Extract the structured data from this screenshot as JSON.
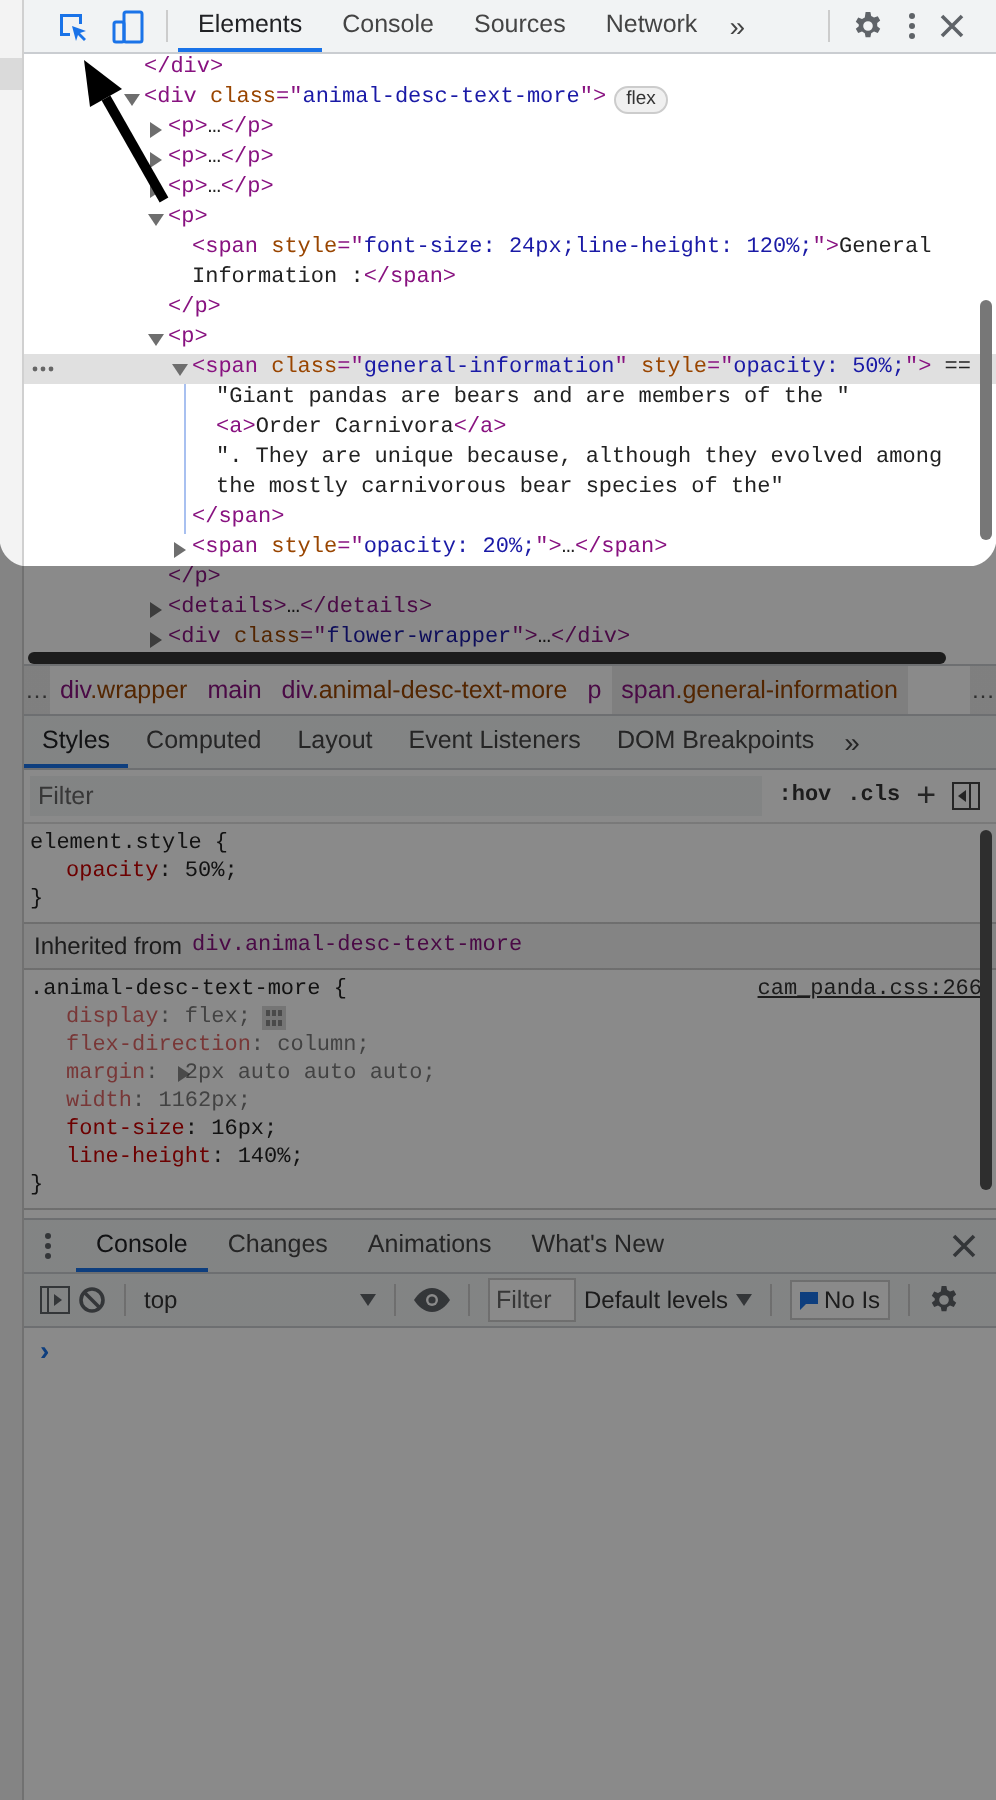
{
  "toolbar": {
    "tabs": [
      {
        "label": "Elements",
        "selected": true
      },
      {
        "label": "Console",
        "selected": false
      },
      {
        "label": "Sources",
        "selected": false
      },
      {
        "label": "Network",
        "selected": false
      }
    ],
    "more": "»"
  },
  "dom": [
    {
      "kind": "leaf",
      "selected": false,
      "line": [
        {
          "kind": "tag",
          "t": "</div>"
        }
      ]
    },
    {
      "kind": "element",
      "expanded": true,
      "selected": false,
      "badge": "flex",
      "line": [
        {
          "kind": "tag",
          "t": "<div "
        },
        {
          "kind": "attr",
          "t": "class"
        },
        {
          "kind": "tag",
          "t": "=\""
        },
        {
          "kind": "val",
          "t": "animal-desc-text-more"
        },
        {
          "kind": "tag",
          "t": "\">"
        }
      ],
      "children": [
        {
          "kind": "element",
          "expanded": false,
          "selected": false,
          "line": [
            {
              "kind": "tag",
              "t": "<p>"
            },
            {
              "kind": "text",
              "t": "…"
            },
            {
              "kind": "tag",
              "t": "</p>"
            }
          ]
        },
        {
          "kind": "element",
          "expanded": false,
          "selected": false,
          "line": [
            {
              "kind": "tag",
              "t": "<p>"
            },
            {
              "kind": "text",
              "t": "…"
            },
            {
              "kind": "tag",
              "t": "</p>"
            }
          ]
        },
        {
          "kind": "element",
          "expanded": false,
          "selected": false,
          "line": [
            {
              "kind": "tag",
              "t": "<p>"
            },
            {
              "kind": "text",
              "t": "…"
            },
            {
              "kind": "tag",
              "t": "</p>"
            }
          ]
        },
        {
          "kind": "element",
          "expanded": true,
          "selected": false,
          "line": [
            {
              "kind": "tag",
              "t": "<p>"
            }
          ],
          "close": [
            {
              "kind": "tag",
              "t": "</p>"
            }
          ],
          "children": [
            {
              "kind": "leaf",
              "selected": false,
              "line": [
                {
                  "kind": "tag",
                  "t": "<span "
                },
                {
                  "kind": "attr",
                  "t": "style"
                },
                {
                  "kind": "tag",
                  "t": "=\""
                },
                {
                  "kind": "val",
                  "t": "font-size: 24px;line-height: 120%;"
                },
                {
                  "kind": "tag",
                  "t": "\">"
                },
                {
                  "kind": "text",
                  "t": "General Information :"
                },
                {
                  "kind": "tag",
                  "t": "</span>"
                }
              ]
            }
          ]
        },
        {
          "kind": "element",
          "expanded": true,
          "selected": false,
          "line": [
            {
              "kind": "tag",
              "t": "<p>"
            }
          ],
          "close": [
            {
              "kind": "tag",
              "t": "</p>"
            }
          ],
          "children": [
            {
              "kind": "element",
              "expanded": true,
              "selected": true,
              "line": [
                {
                  "kind": "tag",
                  "t": "<span "
                },
                {
                  "kind": "attr",
                  "t": "class"
                },
                {
                  "kind": "tag",
                  "t": "=\""
                },
                {
                  "kind": "val",
                  "t": "general-information"
                },
                {
                  "kind": "tag",
                  "t": "\" "
                },
                {
                  "kind": "attr",
                  "t": "style"
                },
                {
                  "kind": "tag",
                  "t": "=\""
                },
                {
                  "kind": "val",
                  "t": "opacity: 50%;"
                },
                {
                  "kind": "tag",
                  "t": "\">"
                },
                {
                  "kind": "text",
                  "t": " =="
                }
              ],
              "close": [
                {
                  "kind": "tag",
                  "t": "</span>"
                }
              ],
              "children": [
                {
                  "kind": "leaf",
                  "selected": false,
                  "line": [
                    {
                      "kind": "text",
                      "t": "\"Giant pandas are bears and are members of the \""
                    }
                  ]
                },
                {
                  "kind": "leaf",
                  "selected": false,
                  "line": [
                    {
                      "kind": "tag",
                      "t": "<a>"
                    },
                    {
                      "kind": "text",
                      "t": "Order Carnivora"
                    },
                    {
                      "kind": "tag",
                      "t": "</a>"
                    }
                  ]
                },
                {
                  "kind": "leaf",
                  "selected": false,
                  "line": [
                    {
                      "kind": "text",
                      "t": "\". They are unique because, although they evolved among the mostly carnivorous bear species of the\""
                    }
                  ]
                }
              ]
            },
            {
              "kind": "element",
              "expanded": false,
              "selected": false,
              "line": [
                {
                  "kind": "tag",
                  "t": "<span "
                },
                {
                  "kind": "attr",
                  "t": "style"
                },
                {
                  "kind": "tag",
                  "t": "=\""
                },
                {
                  "kind": "val",
                  "t": "opacity: 20%;"
                },
                {
                  "kind": "tag",
                  "t": "\">"
                },
                {
                  "kind": "text",
                  "t": "…"
                },
                {
                  "kind": "tag",
                  "t": "</span>"
                }
              ]
            }
          ]
        },
        {
          "kind": "element",
          "expanded": false,
          "selected": false,
          "line": [
            {
              "kind": "tag",
              "t": "<details>"
            },
            {
              "kind": "text",
              "t": "…"
            },
            {
              "kind": "tag",
              "t": "</details>"
            }
          ]
        },
        {
          "kind": "element",
          "expanded": false,
          "selected": false,
          "line": [
            {
              "kind": "tag",
              "t": "<div "
            },
            {
              "kind": "attr",
              "t": "class"
            },
            {
              "kind": "tag",
              "t": "=\""
            },
            {
              "kind": "val",
              "t": "flower-wrapper"
            },
            {
              "kind": "tag",
              "t": "\">"
            },
            {
              "kind": "text",
              "t": "…"
            },
            {
              "kind": "tag",
              "t": "</div>"
            }
          ]
        }
      ]
    }
  ],
  "breadcrumbs": {
    "scroll_left": "…",
    "scroll_right": "…",
    "items": [
      {
        "tag": "div",
        "cls": ".wrapper",
        "selected": false
      },
      {
        "tag": "main",
        "selected": false
      },
      {
        "tag": "div",
        "cls": ".animal-desc-text-more",
        "selected": false
      },
      {
        "tag": "p",
        "selected": false
      },
      {
        "tag": "span",
        "cls": ".general-information",
        "selected": true
      }
    ]
  },
  "styles": {
    "tabs": [
      {
        "label": "Styles",
        "selected": true
      },
      {
        "label": "Computed",
        "selected": false
      },
      {
        "label": "Layout",
        "selected": false
      },
      {
        "label": "Event Listeners",
        "selected": false
      },
      {
        "label": "DOM Breakpoints",
        "selected": false
      }
    ],
    "more": "»",
    "filter": {
      "placeholder": "Filter"
    },
    "hov": ":hov",
    "cls": ".cls",
    "add": "+",
    "rules": [
      {
        "selector": "element.style {",
        "end": "}",
        "props": [
          {
            "kind": "plain",
            "name": "opacity",
            "value": ": 50%;",
            "inactive": false
          }
        ]
      }
    ],
    "inherited": {
      "label": "Inherited from",
      "source": "div.animal-desc-text-more"
    },
    "inherited_rules": [
      {
        "selector": ".animal-desc-text-more {",
        "link": "cam_panda.css:266",
        "end": "}",
        "props": [
          {
            "kind": "flex",
            "name": "display",
            "value": ": flex;",
            "inactive": true
          },
          {
            "kind": "plain",
            "name": "flex-direction",
            "value": ": column;",
            "inactive": true
          },
          {
            "kind": "shorthand",
            "name": "margin",
            "value": ":  2px auto auto auto;",
            "inactive": true
          },
          {
            "kind": "plain",
            "name": "width",
            "value": ": 1162px;",
            "inactive": true
          },
          {
            "kind": "plain",
            "name": "font-size",
            "value": ": 16px;",
            "inactive": false
          },
          {
            "kind": "plain",
            "name": "line-height",
            "value": ": 140%;",
            "inactive": false
          }
        ]
      }
    ]
  },
  "drawer": {
    "tabs": [
      {
        "label": "Console",
        "selected": true
      },
      {
        "label": "Changes",
        "selected": false
      },
      {
        "label": "Animations",
        "selected": false
      },
      {
        "label": "What's New",
        "selected": false
      }
    ],
    "context": "top",
    "filter": {
      "placeholder": "Filter"
    },
    "levels": "Default levels",
    "issues": "No Is",
    "prompt": "›"
  }
}
